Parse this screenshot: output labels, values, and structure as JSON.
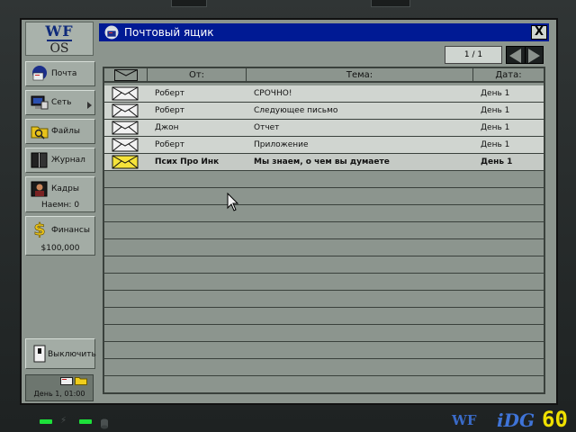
{
  "logo": {
    "line1": "WF",
    "line2": "OS"
  },
  "sidebar": {
    "items": [
      {
        "label": "Почта",
        "icon": "mail-icon"
      },
      {
        "label": "Сеть",
        "icon": "network-icon"
      },
      {
        "label": "Файлы",
        "icon": "files-icon"
      },
      {
        "label": "Журнал",
        "icon": "journal-icon"
      },
      {
        "label": "Кадры",
        "sub": "Наемн: 0",
        "icon": "personnel-icon"
      },
      {
        "label": "Финансы",
        "sub": "$100,000",
        "icon": "finance-icon"
      }
    ],
    "shutdown_label": "Выключить",
    "clock": "День 1, 01:00"
  },
  "window": {
    "title": "Почтовый ящик",
    "close_label": "X",
    "pager": "1 / 1"
  },
  "table": {
    "headers": {
      "from": "От:",
      "subject": "Тема:",
      "date": "Дата:"
    },
    "rows": [
      {
        "from": "Роберт",
        "subject": "СРОЧНО!",
        "date": "День 1",
        "unread": false
      },
      {
        "from": "Роберт",
        "subject": "Следующее письмо",
        "date": "День 1",
        "unread": false
      },
      {
        "from": "Джон",
        "subject": "Отчет",
        "date": "День 1",
        "unread": false
      },
      {
        "from": "Роберт",
        "subject": "Приложение",
        "date": "День 1",
        "unread": false
      },
      {
        "from": "Псих Про Инк",
        "subject": "Мы знаем, о чем вы думаете",
        "date": "День 1",
        "unread": true
      }
    ]
  },
  "footer": {
    "brand_wf": "WF",
    "brand_idg": "iDG",
    "fps": "60"
  },
  "colors": {
    "titlebar": "#001a94",
    "unread_envelope": "#f5e33a",
    "led": "#1de03a"
  }
}
